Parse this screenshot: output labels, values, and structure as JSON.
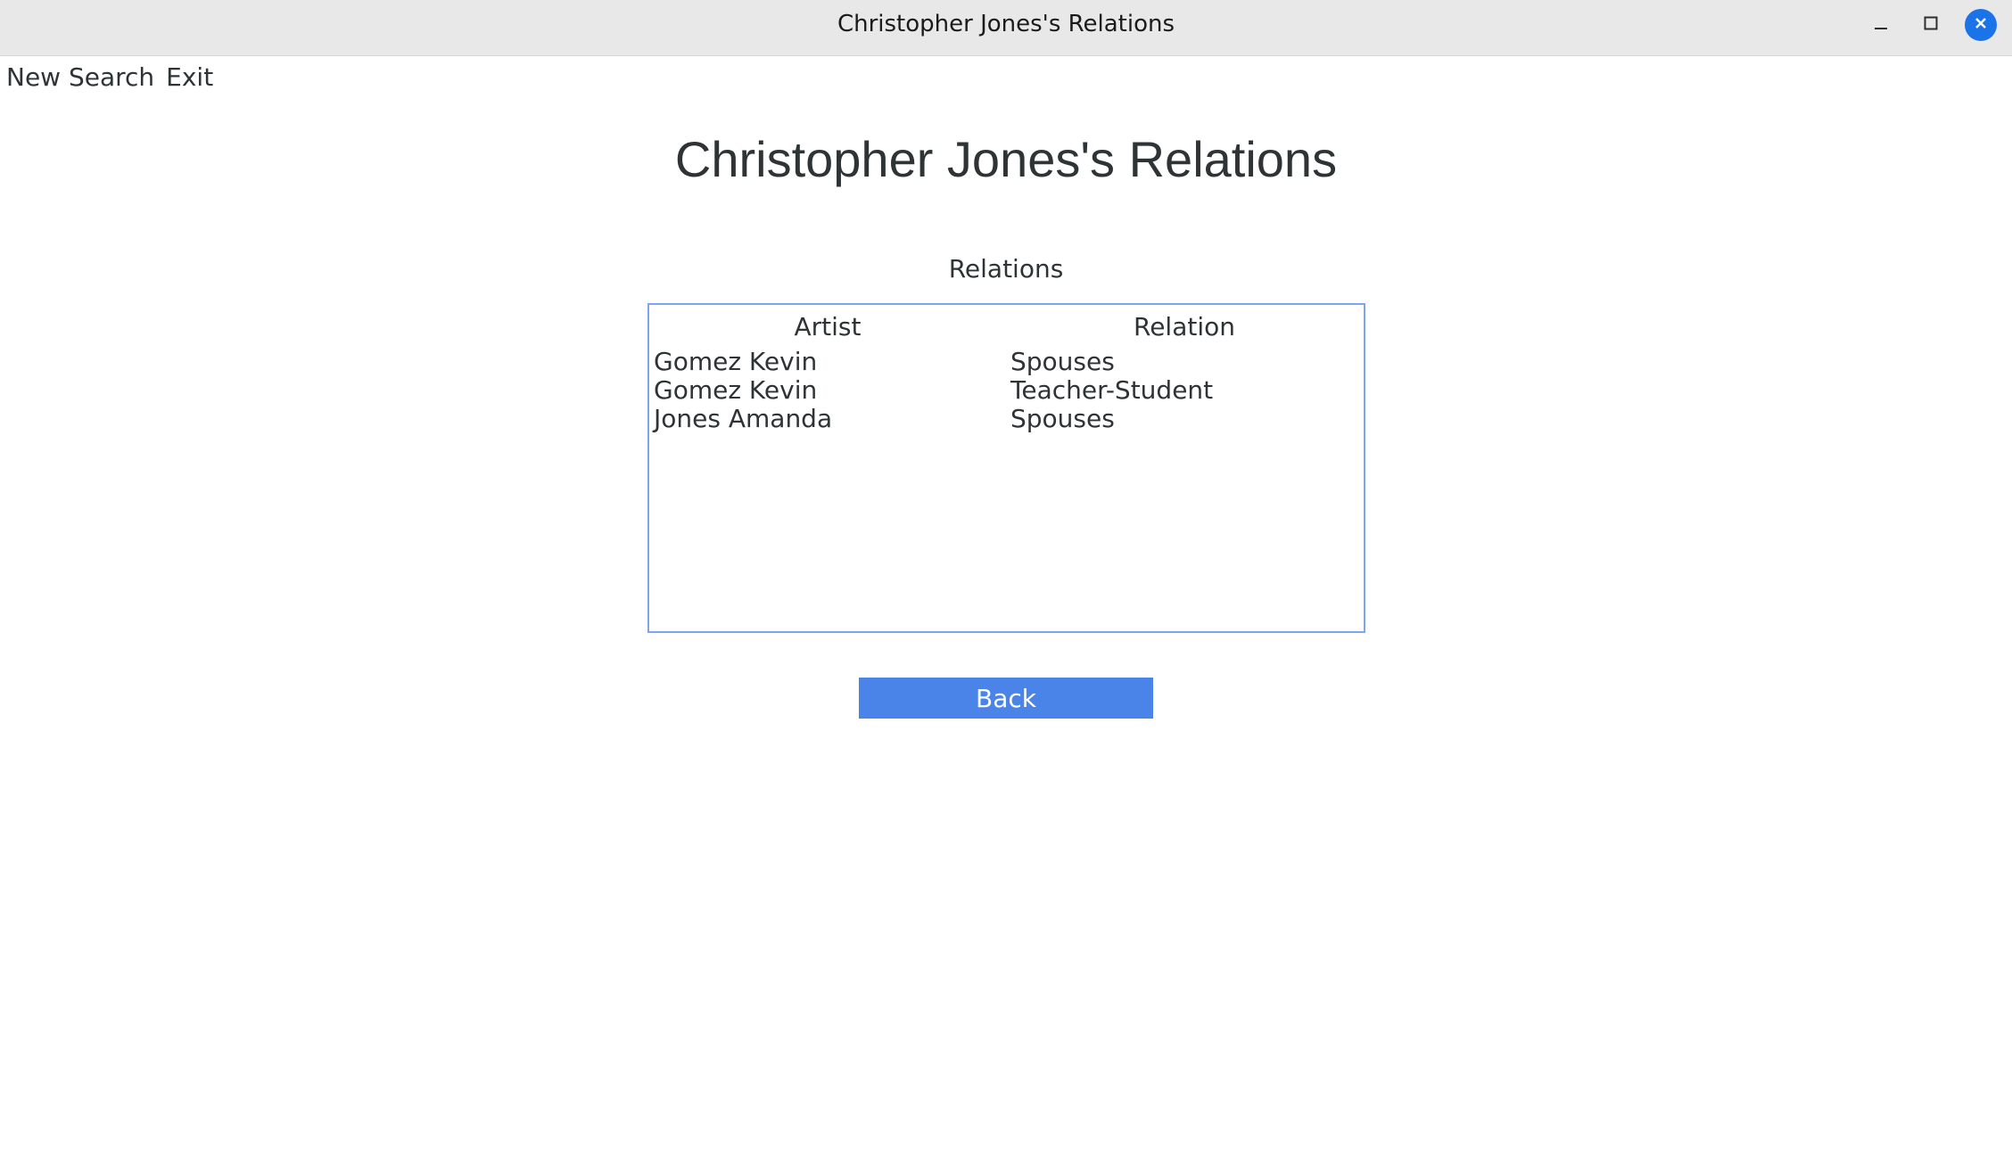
{
  "window": {
    "title": "Christopher Jones's Relations",
    "controls": {
      "minimize_icon": "minimize-icon",
      "maximize_icon": "maximize-icon",
      "close_icon": "close-icon",
      "close_color": "#1a73e8"
    }
  },
  "menu": {
    "items": [
      {
        "label": "New Search"
      },
      {
        "label": "Exit"
      }
    ]
  },
  "page": {
    "title": "Christopher Jones's Relations",
    "section_label": "Relations"
  },
  "table": {
    "columns": [
      "Artist",
      "Relation"
    ],
    "rows": [
      {
        "artist": "Gomez Kevin",
        "relation": "Spouses"
      },
      {
        "artist": "Gomez Kevin",
        "relation": "Teacher-Student"
      },
      {
        "artist": "Jones Amanda",
        "relation": "Spouses"
      }
    ],
    "border_color": "#7ea6f0"
  },
  "buttons": {
    "back_label": "Back",
    "back_color": "#4a84e8"
  }
}
